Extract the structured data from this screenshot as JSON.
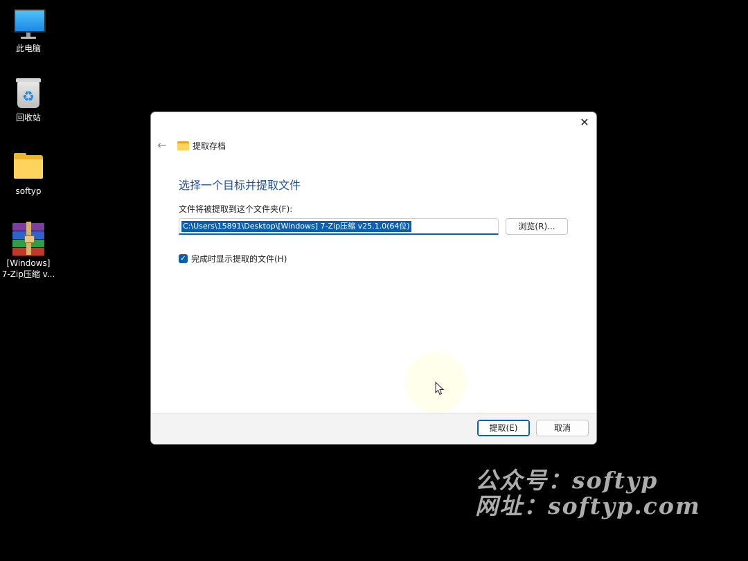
{
  "desktop": {
    "icons": [
      {
        "label": "此电脑",
        "icon": "computer-icon"
      },
      {
        "label": "回收站",
        "icon": "recycle-bin-icon"
      },
      {
        "label": "softyp",
        "icon": "folder-icon"
      },
      {
        "label": "[Windows]\n7-Zip压缩 v...",
        "icon": "winrar-archive-icon"
      }
    ]
  },
  "dialog": {
    "header_title": "提取存档",
    "close_glyph": "✕",
    "back_glyph": "←",
    "main_title": "选择一个目标并提取文件",
    "field_label": "文件将被提取到这个文件夹(F):",
    "path_value": "C:\\Users\\15891\\Desktop\\[Windows] 7-Zip压缩 v25.1.0(64位)",
    "browse_label": "浏览(R)...",
    "checkbox_label": "完成时显示提取的文件(H)",
    "checkbox_checked": true,
    "checkbox_glyph": "✓",
    "extract_label": "提取(E)",
    "cancel_label": "取消"
  },
  "watermark": {
    "line1": "公众号：softyp",
    "line2": "网址：softyp.com"
  },
  "colors": {
    "accent": "#0a5fb4",
    "title_blue": "#1f4e9c"
  }
}
